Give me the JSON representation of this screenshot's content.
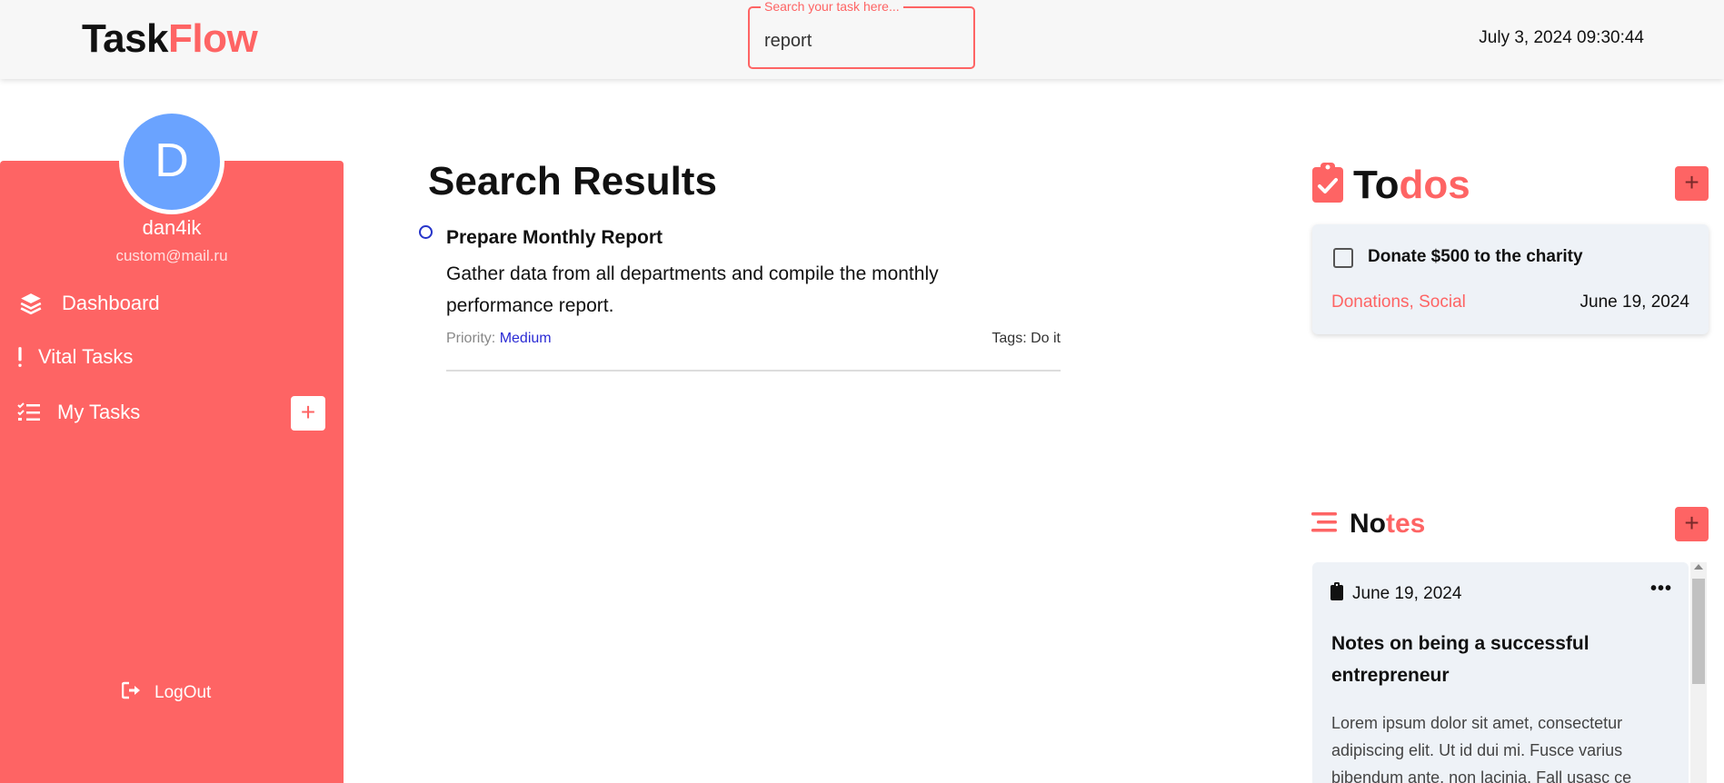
{
  "header": {
    "logo_main": "Task",
    "logo_accent": "Flow",
    "search_legend": "Search your task here...",
    "search_value": "report",
    "datetime": "July 3, 2024 09:30:44"
  },
  "sidebar": {
    "avatar_letter": "D",
    "username": "dan4ik",
    "email": "custom@mail.ru",
    "nav": {
      "dashboard": "Dashboard",
      "vital_tasks": "Vital Tasks",
      "my_tasks": "My Tasks"
    },
    "add_task_label": "+",
    "logout": "LogOut"
  },
  "main": {
    "title": "Search Results",
    "results": [
      {
        "title": "Prepare Monthly Report",
        "description": "Gather data from all departments and compile the monthly performance report.",
        "priority_label": "Priority:",
        "priority_value": "Medium",
        "tags": "Tags: Do it"
      }
    ]
  },
  "todos": {
    "title_main": "To",
    "title_accent": "dos",
    "add_label": "+",
    "items": [
      {
        "title": "Donate $500 to the charity",
        "tags": "Donations, Social",
        "date": "June 19, 2024"
      }
    ]
  },
  "notes": {
    "title_main": "No",
    "title_accent": "tes",
    "add_label": "+",
    "items": [
      {
        "date": "June 19, 2024",
        "more": "•••",
        "title": "Notes on being a successful entrepreneur",
        "body_lines": [
          "Lorem ipsum dolor sit amet, consectetur",
          "adipiscing elit. Ut id dui mi. Fusce varius",
          "bibendum ante, non lacinia. Fall usasc ce"
        ]
      }
    ]
  },
  "colors": {
    "accent": "#fe6464",
    "avatar": "#6aa3ff",
    "priority_medium": "#2a2ad4",
    "card_bg": "#eef2f7"
  }
}
